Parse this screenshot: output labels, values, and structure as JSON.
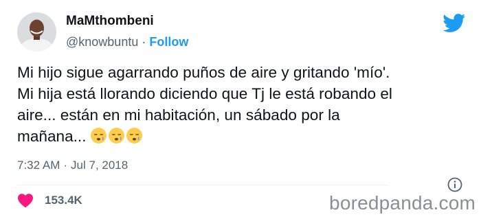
{
  "user": {
    "name": "MaMthombeni",
    "handle": "@knowbuntu",
    "separator": "·",
    "follow_label": "Follow"
  },
  "tweet": {
    "lines": [
      "Mi hijo sigue agarrando puños de aire y gritando 'mío'.",
      "Mi hija está llorando diciendo que Tj le está robando el",
      "aire... están en mi habitación, un sábado por la",
      "mañana..."
    ],
    "emojis": [
      "sleepy-face",
      "sleepy-face",
      "sleepy-face"
    ]
  },
  "meta": {
    "time": "7:32 AM",
    "separator": "·",
    "date": "Jul 7, 2018"
  },
  "engagement": {
    "likes": "153.4K"
  },
  "icons": {
    "brand": "twitter-bird-icon",
    "info": "info-circle-icon",
    "like": "heart-icon"
  },
  "colors": {
    "brand_blue": "#1d9bf0",
    "like_pink": "#f91880",
    "text_primary": "#0f1419",
    "text_secondary": "#536471"
  },
  "watermark": "boredpanda.com"
}
